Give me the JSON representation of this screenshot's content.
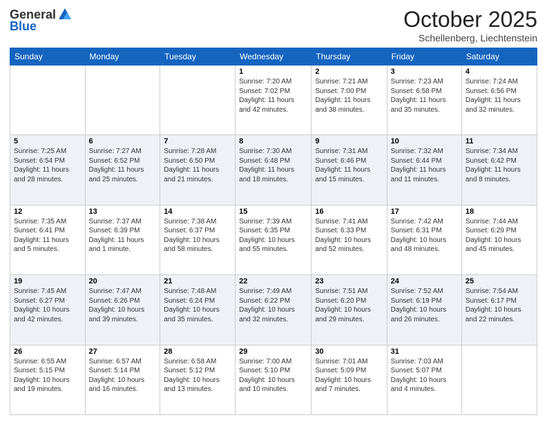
{
  "logo": {
    "general": "General",
    "blue": "Blue"
  },
  "header": {
    "month": "October 2025",
    "location": "Schellenberg, Liechtenstein"
  },
  "weekdays": [
    "Sunday",
    "Monday",
    "Tuesday",
    "Wednesday",
    "Thursday",
    "Friday",
    "Saturday"
  ],
  "weeks": [
    [
      null,
      null,
      null,
      {
        "day": "1",
        "sunrise": "7:20 AM",
        "sunset": "7:02 PM",
        "daylight": "11 hours and 42 minutes."
      },
      {
        "day": "2",
        "sunrise": "7:21 AM",
        "sunset": "7:00 PM",
        "daylight": "11 hours and 38 minutes."
      },
      {
        "day": "3",
        "sunrise": "7:23 AM",
        "sunset": "6:58 PM",
        "daylight": "11 hours and 35 minutes."
      },
      {
        "day": "4",
        "sunrise": "7:24 AM",
        "sunset": "6:56 PM",
        "daylight": "11 hours and 32 minutes."
      }
    ],
    [
      {
        "day": "5",
        "sunrise": "7:25 AM",
        "sunset": "6:54 PM",
        "daylight": "11 hours and 28 minutes."
      },
      {
        "day": "6",
        "sunrise": "7:27 AM",
        "sunset": "6:52 PM",
        "daylight": "11 hours and 25 minutes."
      },
      {
        "day": "7",
        "sunrise": "7:28 AM",
        "sunset": "6:50 PM",
        "daylight": "11 hours and 21 minutes."
      },
      {
        "day": "8",
        "sunrise": "7:30 AM",
        "sunset": "6:48 PM",
        "daylight": "11 hours and 18 minutes."
      },
      {
        "day": "9",
        "sunrise": "7:31 AM",
        "sunset": "6:46 PM",
        "daylight": "11 hours and 15 minutes."
      },
      {
        "day": "10",
        "sunrise": "7:32 AM",
        "sunset": "6:44 PM",
        "daylight": "11 hours and 11 minutes."
      },
      {
        "day": "11",
        "sunrise": "7:34 AM",
        "sunset": "6:42 PM",
        "daylight": "11 hours and 8 minutes."
      }
    ],
    [
      {
        "day": "12",
        "sunrise": "7:35 AM",
        "sunset": "6:41 PM",
        "daylight": "11 hours and 5 minutes."
      },
      {
        "day": "13",
        "sunrise": "7:37 AM",
        "sunset": "6:39 PM",
        "daylight": "11 hours and 1 minute."
      },
      {
        "day": "14",
        "sunrise": "7:38 AM",
        "sunset": "6:37 PM",
        "daylight": "10 hours and 58 minutes."
      },
      {
        "day": "15",
        "sunrise": "7:39 AM",
        "sunset": "6:35 PM",
        "daylight": "10 hours and 55 minutes."
      },
      {
        "day": "16",
        "sunrise": "7:41 AM",
        "sunset": "6:33 PM",
        "daylight": "10 hours and 52 minutes."
      },
      {
        "day": "17",
        "sunrise": "7:42 AM",
        "sunset": "6:31 PM",
        "daylight": "10 hours and 48 minutes."
      },
      {
        "day": "18",
        "sunrise": "7:44 AM",
        "sunset": "6:29 PM",
        "daylight": "10 hours and 45 minutes."
      }
    ],
    [
      {
        "day": "19",
        "sunrise": "7:45 AM",
        "sunset": "6:27 PM",
        "daylight": "10 hours and 42 minutes."
      },
      {
        "day": "20",
        "sunrise": "7:47 AM",
        "sunset": "6:26 PM",
        "daylight": "10 hours and 39 minutes."
      },
      {
        "day": "21",
        "sunrise": "7:48 AM",
        "sunset": "6:24 PM",
        "daylight": "10 hours and 35 minutes."
      },
      {
        "day": "22",
        "sunrise": "7:49 AM",
        "sunset": "6:22 PM",
        "daylight": "10 hours and 32 minutes."
      },
      {
        "day": "23",
        "sunrise": "7:51 AM",
        "sunset": "6:20 PM",
        "daylight": "10 hours and 29 minutes."
      },
      {
        "day": "24",
        "sunrise": "7:52 AM",
        "sunset": "6:19 PM",
        "daylight": "10 hours and 26 minutes."
      },
      {
        "day": "25",
        "sunrise": "7:54 AM",
        "sunset": "6:17 PM",
        "daylight": "10 hours and 22 minutes."
      }
    ],
    [
      {
        "day": "26",
        "sunrise": "6:55 AM",
        "sunset": "5:15 PM",
        "daylight": "10 hours and 19 minutes."
      },
      {
        "day": "27",
        "sunrise": "6:57 AM",
        "sunset": "5:14 PM",
        "daylight": "10 hours and 16 minutes."
      },
      {
        "day": "28",
        "sunrise": "6:58 AM",
        "sunset": "5:12 PM",
        "daylight": "10 hours and 13 minutes."
      },
      {
        "day": "29",
        "sunrise": "7:00 AM",
        "sunset": "5:10 PM",
        "daylight": "10 hours and 10 minutes."
      },
      {
        "day": "30",
        "sunrise": "7:01 AM",
        "sunset": "5:09 PM",
        "daylight": "10 hours and 7 minutes."
      },
      {
        "day": "31",
        "sunrise": "7:03 AM",
        "sunset": "5:07 PM",
        "daylight": "10 hours and 4 minutes."
      },
      null
    ]
  ]
}
